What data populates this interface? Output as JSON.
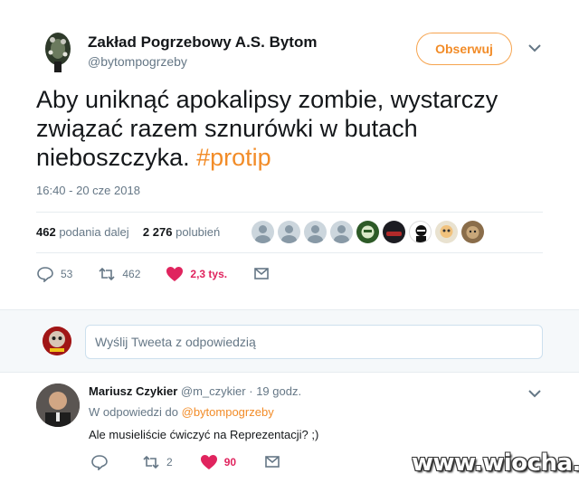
{
  "tweet": {
    "author_name": "Zakład Pogrzebowy A.S. Bytom",
    "author_handle": "@bytompogrzeby",
    "follow_label": "Obserwuj",
    "text_main": "Aby uniknąć apokalipsy zombie, wystarczy związać razem sznurówki w butach nieboszczyka.",
    "hashtag": "#protip",
    "timestamp": "16:40 - 20 cze 2018",
    "retweets_count": "462",
    "retweets_label": "podania dalej",
    "likes_count": "2 276",
    "likes_label": "polubień",
    "reply_action_count": "53",
    "retweet_action_count": "462",
    "like_action_count": "2,3 tys.",
    "like_color": "#e0245e",
    "accent_color": "#f28c28",
    "liker_faces": [
      "default-avatar",
      "default-avatar",
      "default-avatar",
      "default-avatar",
      "green-avatar",
      "car-avatar",
      "dark-avatar",
      "cartoon-avatar",
      "cat-avatar"
    ]
  },
  "compose": {
    "placeholder": "Wyślij Tweeta z odpowiedzią"
  },
  "reply": {
    "author_name": "Mariusz Czykier",
    "author_handle": "@m_czykier",
    "separator": "·",
    "time": "19 godz.",
    "reply_to_prefix": "W odpowiedzi do",
    "reply_to_handle": "@bytompogrzeby",
    "text": "Ale musieliście ćwiczyć na Reprezentacji? ;)",
    "reply_count": "",
    "retweet_count": "2",
    "like_count": "90"
  },
  "watermark": "www.wiocha.pl"
}
